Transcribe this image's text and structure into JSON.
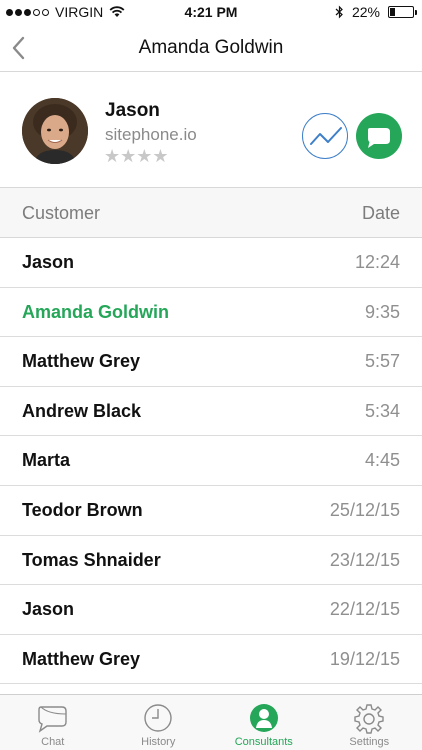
{
  "status_bar": {
    "carrier": "VIRGIN",
    "time": "4:21 PM",
    "battery": "22%",
    "battery_level": 0.22,
    "signal_bars_filled": 3,
    "signal_bars_total": 5
  },
  "nav": {
    "title": "Amanda Goldwin",
    "back_icon": "chevron-left-icon"
  },
  "profile": {
    "name": "Jason",
    "site": "sitephone.io",
    "rating_stars": "★★★★",
    "rating_value": 0,
    "rating_max": 4,
    "actions": {
      "chart_icon": "trend-line-icon",
      "chat_icon": "chat-bubble-icon"
    }
  },
  "table": {
    "header_customer": "Customer",
    "header_date": "Date",
    "rows": [
      {
        "name": "Jason",
        "date": "12:24"
      },
      {
        "name": "Amanda Goldwin",
        "date": "9:35"
      },
      {
        "name": "Matthew Grey",
        "date": "5:57"
      },
      {
        "name": "Andrew Black",
        "date": "5:34"
      },
      {
        "name": "Marta",
        "date": "4:45"
      },
      {
        "name": "Teodor Brown",
        "date": "25/12/15"
      },
      {
        "name": "Tomas Shnaider",
        "date": "23/12/15"
      },
      {
        "name": "Jason",
        "date": "22/12/15"
      },
      {
        "name": "Matthew Grey",
        "date": "19/12/15"
      }
    ],
    "active_row": "Amanda Goldwin"
  },
  "tabs": [
    {
      "label": "Chat",
      "icon": "chat-bubble-icon"
    },
    {
      "label": "History",
      "icon": "clock-icon"
    },
    {
      "label": "Consultants",
      "icon": "person-icon",
      "active": true
    },
    {
      "label": "Settings",
      "icon": "gear-icon"
    }
  ],
  "colors": {
    "accent_green": "#25a659",
    "accent_blue": "#3d7fc9",
    "muted_text": "#8a8a8a",
    "divider": "#d8d8d8"
  }
}
